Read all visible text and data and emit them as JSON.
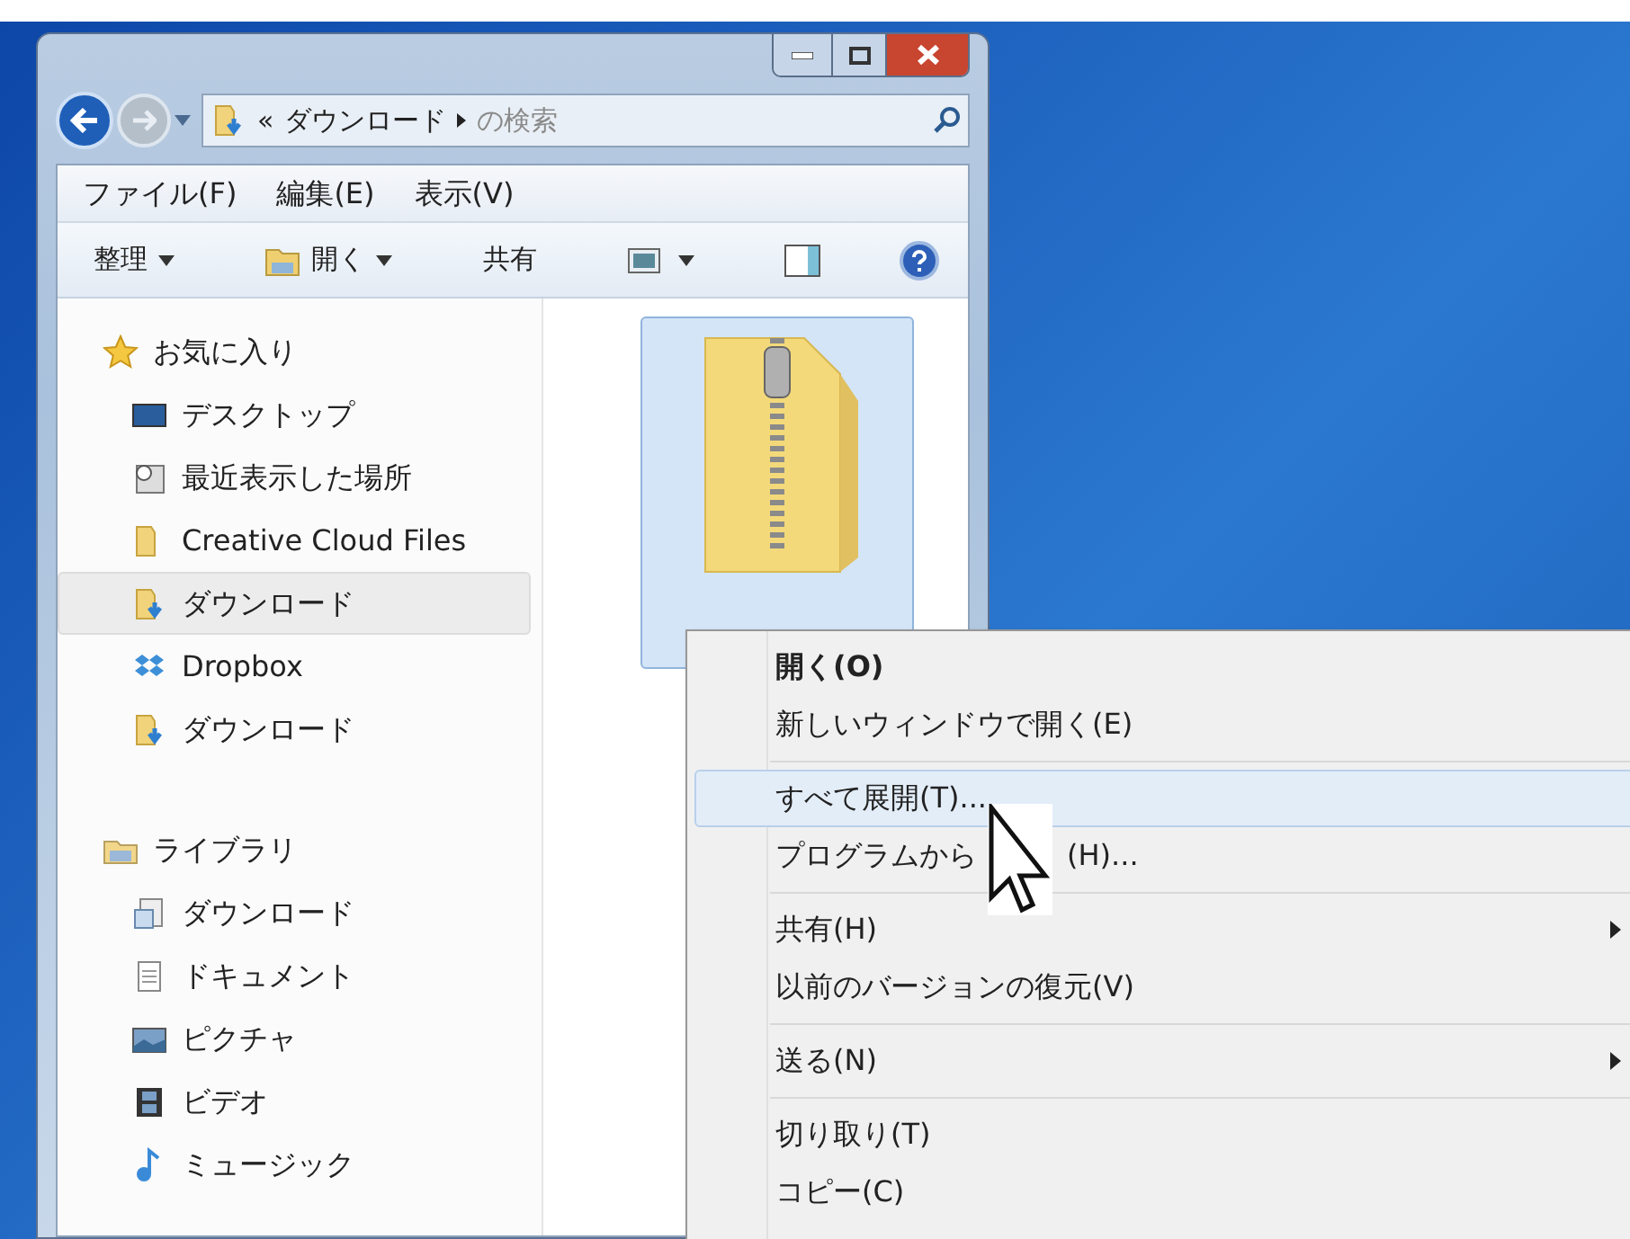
{
  "address": {
    "overflow": "«",
    "path": "ダウンロード",
    "search_placeholder": "の検索"
  },
  "menu_bar": [
    "ファイル(F)",
    "編集(E)",
    "表示(V)"
  ],
  "toolbar": [
    {
      "kind": "dropdown",
      "label": "整理"
    },
    {
      "kind": "open",
      "label": "開く"
    },
    {
      "kind": "text",
      "label": "共有"
    },
    {
      "kind": "view"
    },
    {
      "kind": "pane"
    },
    {
      "kind": "help"
    }
  ],
  "navigation": [
    {
      "kind": "favorites",
      "label": "お気に入り",
      "selected": false,
      "children": [
        {
          "kind": "desktop",
          "label": "デスクトップ",
          "selected": false
        },
        {
          "kind": "recent",
          "label": "最近表示した場所",
          "selected": false
        },
        {
          "kind": "folder",
          "label": "Creative Cloud Files",
          "selected": false
        },
        {
          "kind": "download",
          "label": "ダウンロード",
          "selected": true
        },
        {
          "kind": "dropbox",
          "label": "Dropbox",
          "selected": false
        },
        {
          "kind": "download",
          "label": "ダウンロード",
          "selected": false
        }
      ]
    },
    {
      "kind": "library",
      "label": "ライブラリ",
      "selected": false,
      "children": [
        {
          "kind": "doclib",
          "label": "ダウンロード",
          "selected": false
        },
        {
          "kind": "document",
          "label": "ドキュメント",
          "selected": false
        },
        {
          "kind": "pictures",
          "label": "ピクチャ",
          "selected": false
        },
        {
          "kind": "video",
          "label": "ビデオ",
          "selected": false
        },
        {
          "kind": "music",
          "label": "ミュージック",
          "selected": false
        }
      ]
    }
  ],
  "file": {
    "selected": true
  },
  "context_menu": [
    {
      "kind": "item",
      "label": "開く(O)",
      "bold": true,
      "selected": false,
      "submenu": false
    },
    {
      "kind": "item",
      "label": "新しいウィンドウで開く(E)",
      "bold": false,
      "selected": false,
      "submenu": false
    },
    {
      "kind": "separator"
    },
    {
      "kind": "item",
      "label": "すべて展開(T)...",
      "bold": false,
      "selected": true,
      "submenu": false
    },
    {
      "kind": "covered",
      "label": "プログラムから",
      "tail": "(H)...",
      "bold": false,
      "selected": false,
      "submenu": false
    },
    {
      "kind": "separator"
    },
    {
      "kind": "item",
      "label": "共有(H)",
      "bold": false,
      "selected": false,
      "submenu": true
    },
    {
      "kind": "item",
      "label": "以前のバージョンの復元(V)",
      "bold": false,
      "selected": false,
      "submenu": false
    },
    {
      "kind": "separator"
    },
    {
      "kind": "item",
      "label": "送る(N)",
      "bold": false,
      "selected": false,
      "submenu": true
    },
    {
      "kind": "separator"
    },
    {
      "kind": "item",
      "label": "切り取り(T)",
      "bold": false,
      "selected": false,
      "submenu": false
    },
    {
      "kind": "item",
      "label": "コピー(C)",
      "bold": false,
      "selected": false,
      "submenu": false
    }
  ]
}
